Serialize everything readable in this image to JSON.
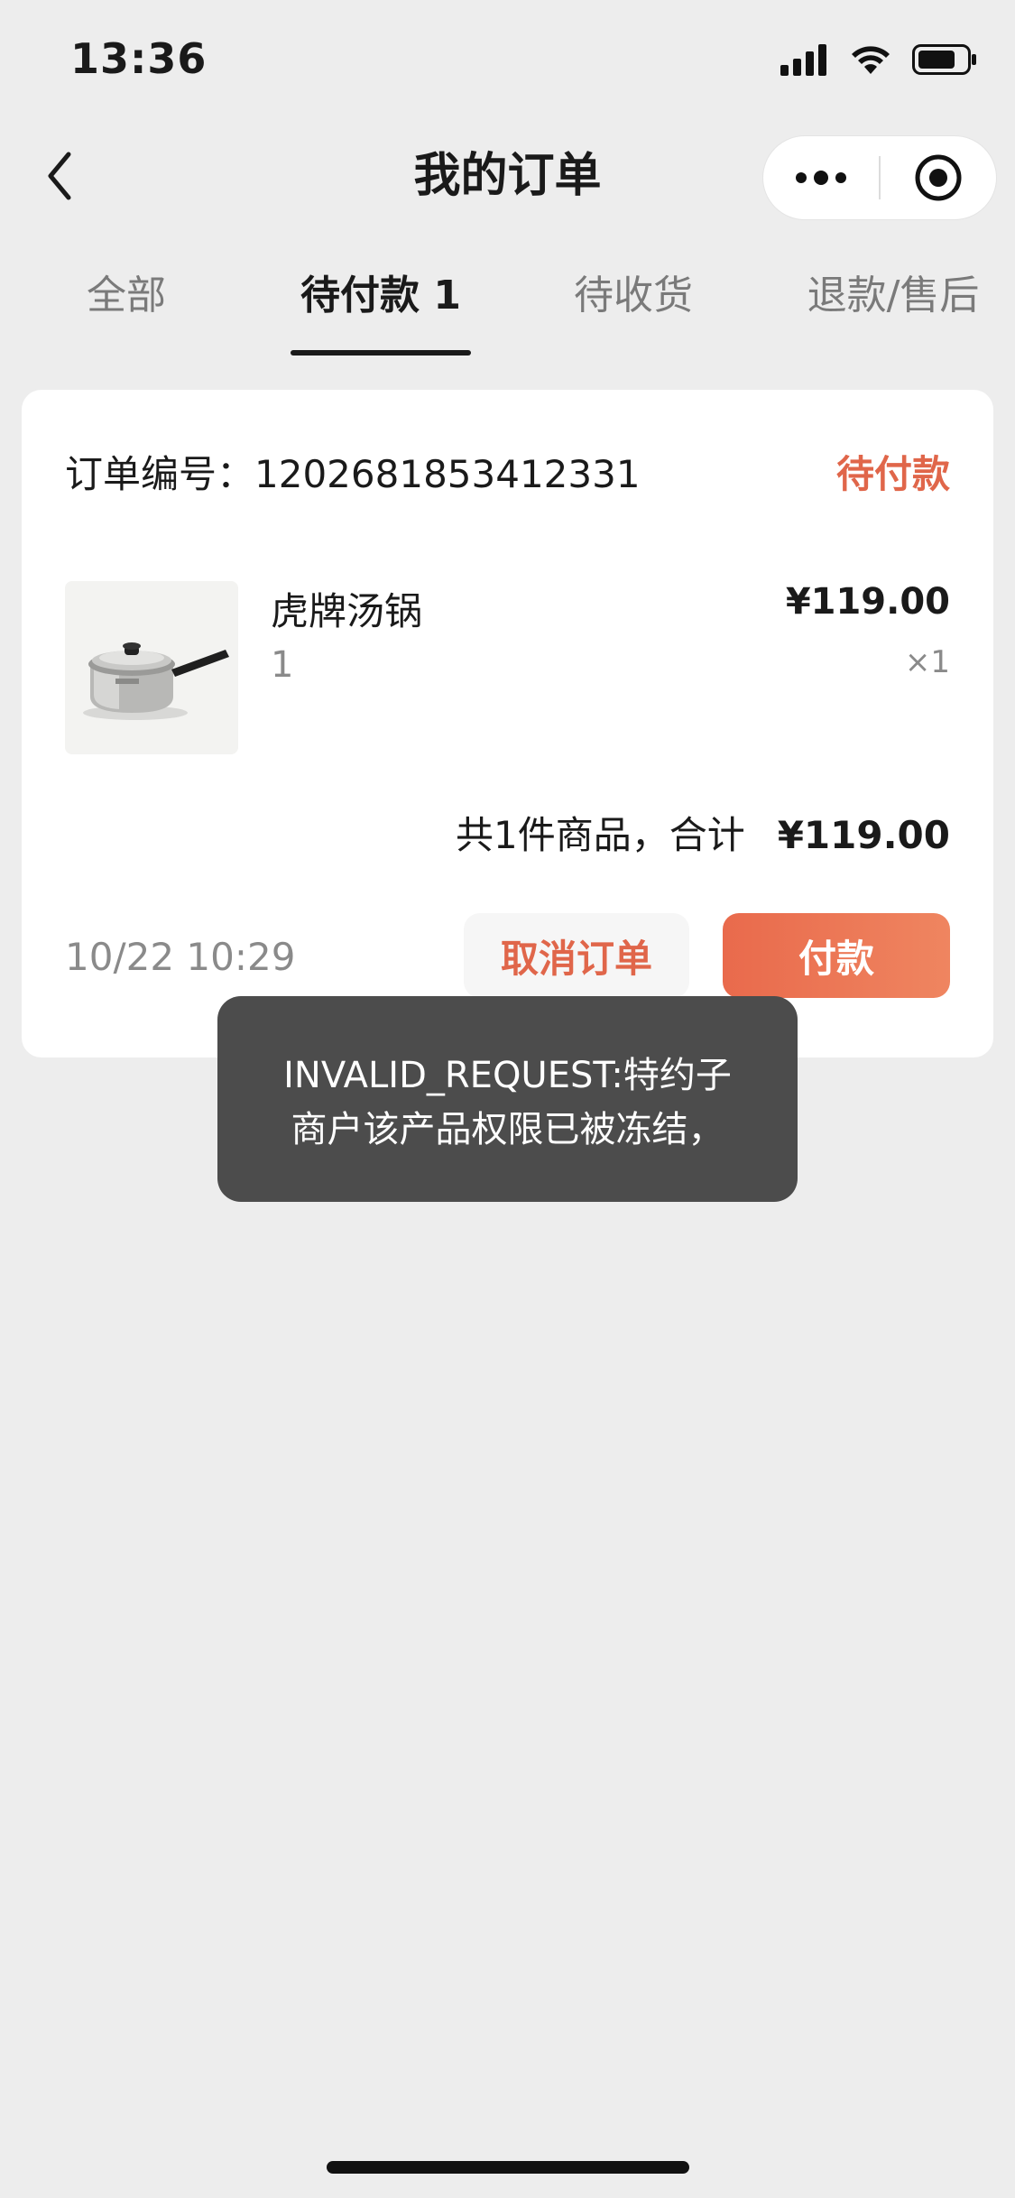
{
  "status_bar": {
    "time": "13:36"
  },
  "nav": {
    "title": "我的订单"
  },
  "tabs": [
    {
      "label": "全部"
    },
    {
      "label": "待付款 1",
      "active": true
    },
    {
      "label": "待收货"
    },
    {
      "label": "退款/售后"
    }
  ],
  "order": {
    "number_label": "订单编号：",
    "number": "1202681853412331",
    "status": "待付款",
    "product": {
      "name": "虎牌汤锅",
      "spec": "1",
      "price": "¥119.00",
      "quantity": "×1",
      "image_icon": "saucepan-image"
    },
    "summary_text": "共1件商品，合计",
    "summary_total": "¥119.00",
    "time": "10/22 10:29",
    "cancel_label": "取消订单",
    "pay_label": "付款"
  },
  "toast": {
    "line1": "INVALID_REQUEST:特约子",
    "line2": "商户该产品权限已被冻结，"
  },
  "colors": {
    "accent": "#e0664a",
    "background": "#ededed",
    "toast_bg": "#4c4c4c"
  }
}
